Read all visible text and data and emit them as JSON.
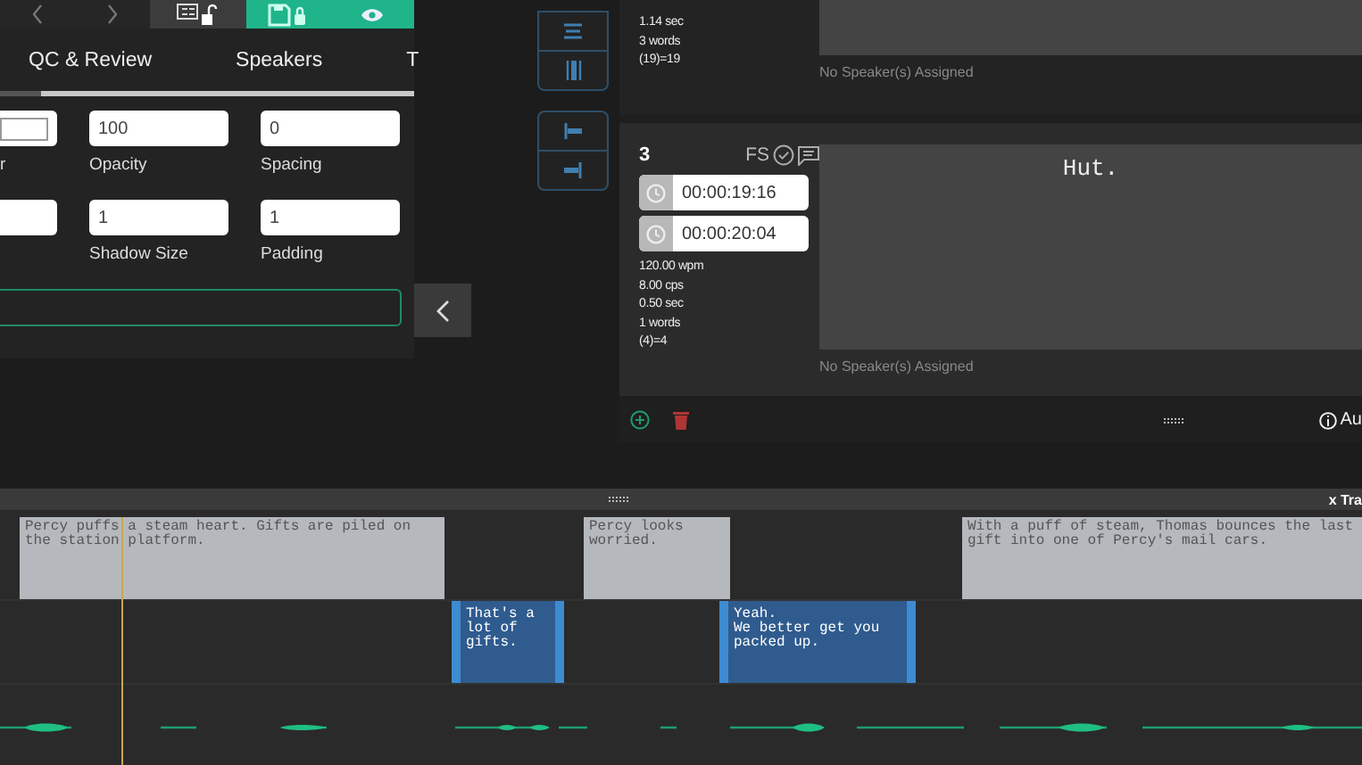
{
  "nav": {
    "buttons": [
      {
        "kind": "prev",
        "active": false
      },
      {
        "kind": "next",
        "active": false
      },
      {
        "kind": "captions-lock",
        "active": false
      },
      {
        "kind": "save-lock",
        "active": true
      },
      {
        "kind": "view",
        "active": true
      }
    ]
  },
  "tabs": [
    {
      "label": "QC & Review"
    },
    {
      "label": "Speakers"
    },
    {
      "label": "T"
    }
  ],
  "form": {
    "rows": [
      [
        {
          "kind": "color",
          "label": "r"
        },
        {
          "kind": "text",
          "value": "100",
          "label": "Opacity"
        },
        {
          "kind": "text",
          "value": "0",
          "label": "Spacing"
        }
      ],
      [
        {
          "kind": "text"
        },
        {
          "kind": "text",
          "value": "1",
          "label": "Shadow Size"
        },
        {
          "kind": "text",
          "value": "1",
          "label": "Padding"
        }
      ]
    ]
  },
  "cards": [
    {
      "stats": [
        "1.14 sec",
        "3 words",
        "(19)=19"
      ],
      "speaker": "No Speaker(s) Assigned"
    },
    {
      "number": "3",
      "flags": "FS",
      "start": "00:00:19:16",
      "end": "00:00:20:04",
      "stats": [
        "120.00 wpm",
        "8.00 cps",
        "0.50 sec",
        "1 words",
        "(4)=4"
      ],
      "text": "Hut.",
      "speaker": "No Speaker(s) Assigned"
    }
  ],
  "footer": {
    "info": "Au"
  },
  "timeline": {
    "close_label": "x Tra",
    "tracks": [
      {
        "kind": "description",
        "clips": [
          {
            "text": "Percy puffs a steam heart. Gifts are piled on the station platform."
          },
          {
            "text": "Percy looks worried."
          },
          {
            "text": "With a puff of steam, Thomas bounces the last gift into one of Percy's mail cars."
          }
        ]
      },
      {
        "kind": "caption",
        "clips": [
          {
            "text": "That's a lot of gifts."
          },
          {
            "text": "Yeah.\nWe better get you packed up."
          }
        ]
      }
    ]
  }
}
